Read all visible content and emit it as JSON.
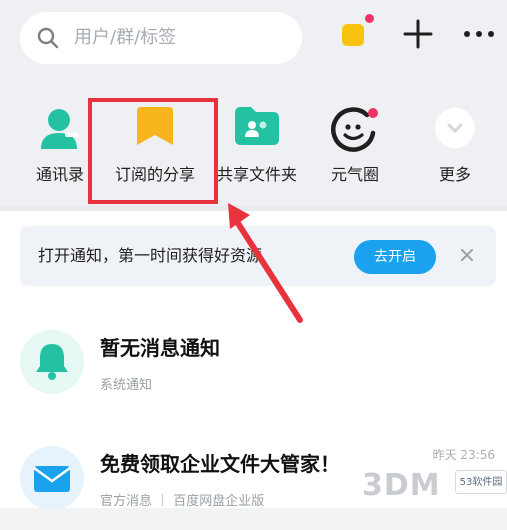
{
  "search": {
    "placeholder": "用户/群/标签"
  },
  "header": {
    "more_label": "···"
  },
  "quick_actions": [
    {
      "label": "通讯录",
      "icon": "contacts-icon",
      "color": "#24c1a3"
    },
    {
      "label": "订阅的分享",
      "icon": "bookmark-icon",
      "color": "#f9b51e"
    },
    {
      "label": "共享文件夹",
      "icon": "shared-folder-icon",
      "color": "#24c1a3"
    },
    {
      "label": "元气圈",
      "icon": "smile-icon",
      "color": "#1f1f1f"
    },
    {
      "label": "更多",
      "icon": "more-circle-icon",
      "color": "#d9dbe0"
    }
  ],
  "notice": {
    "text": "打开通知，第一时间获得好资源",
    "button": "去开启"
  },
  "messages": [
    {
      "title": "暂无消息通知",
      "subtitle": "系统通知",
      "time": "",
      "icon": "bell-icon"
    },
    {
      "title": "免费领取企业文件大管家！",
      "subtitle": "官方消息 ｜ 百度网盘企业版",
      "time": "昨天 23:56",
      "icon": "mail-icon"
    }
  ],
  "watermarks": {
    "brand_3d": "3DM",
    "brand_53": "53软件园"
  },
  "colors": {
    "highlight": "#e8323c",
    "accent": "#1aa2ee",
    "badge": "#f03464"
  }
}
